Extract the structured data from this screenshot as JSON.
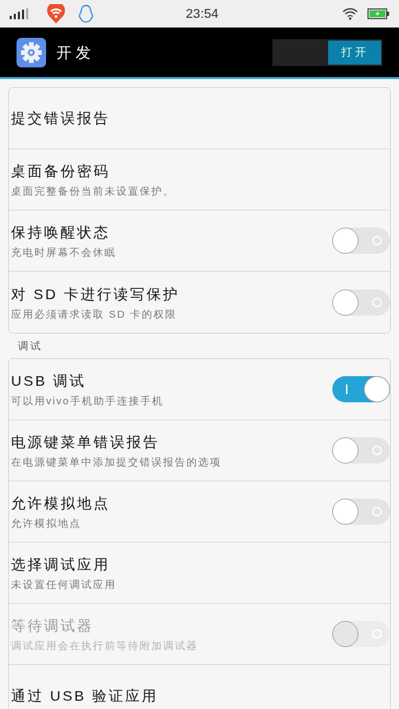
{
  "status_bar": {
    "time": "23:54"
  },
  "header": {
    "title": "开发",
    "switch_label": "打开",
    "switch_on": true
  },
  "groups": [
    {
      "items": [
        {
          "kind": "plain",
          "title": "提交错误报告",
          "disabled": false
        },
        {
          "kind": "text",
          "title": "桌面备份密码",
          "subtitle": "桌面完整备份当前未设置保护。",
          "disabled": false
        },
        {
          "kind": "toggle",
          "title": "保持唤醒状态",
          "subtitle": "充电时屏幕不会休眠",
          "on": false,
          "disabled": false
        },
        {
          "kind": "toggle",
          "title": "对 SD 卡进行读写保护",
          "subtitle": "应用必须请求读取 SD 卡的权限",
          "on": false,
          "disabled": false
        }
      ]
    },
    {
      "label": "调试",
      "items": [
        {
          "kind": "toggle",
          "title": "USB 调试",
          "subtitle": "可以用vivo手机助手连接手机",
          "on": true,
          "disabled": false
        },
        {
          "kind": "toggle",
          "title": "电源键菜单错误报告",
          "subtitle": "在电源键菜单中添加提交错误报告的选项",
          "on": false,
          "disabled": false
        },
        {
          "kind": "toggle",
          "title": "允许模拟地点",
          "subtitle": "允许模拟地点",
          "on": false,
          "disabled": false
        },
        {
          "kind": "text",
          "title": "选择调试应用",
          "subtitle": "未设置任何调试应用",
          "disabled": false
        },
        {
          "kind": "toggle",
          "title": "等待调试器",
          "subtitle": "调试应用会在执行前等待附加调试器",
          "on": false,
          "disabled": true
        },
        {
          "kind": "plain",
          "title": "通过 USB 验证应用",
          "disabled": false
        }
      ]
    }
  ]
}
